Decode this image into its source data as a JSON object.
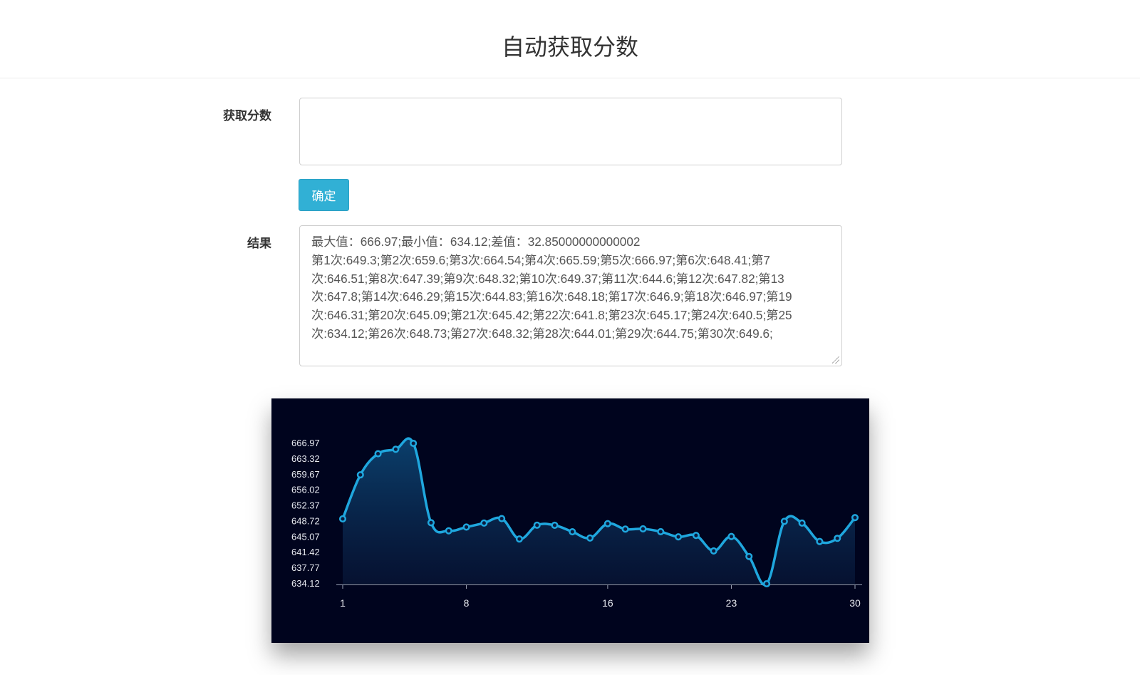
{
  "page": {
    "title": "自动获取分数"
  },
  "form": {
    "score_label": "获取分数",
    "score_value": "",
    "confirm_label": "确定",
    "result_label": "结果",
    "result_lines": [
      "最大值：666.97;最小值：634.12;差值：32.85000000000002",
      "第1次:649.3;第2次:659.6;第3次:664.54;第4次:665.59;第5次:666.97;第6次:648.41;第7",
      "次:646.51;第8次:647.39;第9次:648.32;第10次:649.37;第11次:644.6;第12次:647.82;第13",
      "次:647.8;第14次:646.29;第15次:644.83;第16次:648.18;第17次:646.9;第18次:646.97;第19",
      "次:646.31;第20次:645.09;第21次:645.42;第22次:641.8;第23次:645.17;第24次:640.5;第25",
      "次:634.12;第26次:648.73;第27次:648.32;第28次:644.01;第29次:644.75;第30次:649.6;"
    ]
  },
  "colors": {
    "chart_bg": "#00041e",
    "line": "#1fa7de",
    "axis": "#9aa3b5",
    "text": "#e6e9f0",
    "button": "#31b0d5"
  },
  "chart_data": {
    "type": "area",
    "x": [
      1,
      2,
      3,
      4,
      5,
      6,
      7,
      8,
      9,
      10,
      11,
      12,
      13,
      14,
      15,
      16,
      17,
      18,
      19,
      20,
      21,
      22,
      23,
      24,
      25,
      26,
      27,
      28,
      29,
      30
    ],
    "values": [
      649.3,
      659.6,
      664.54,
      665.59,
      666.97,
      648.41,
      646.51,
      647.39,
      648.32,
      649.37,
      644.6,
      647.82,
      647.8,
      646.29,
      644.83,
      648.18,
      646.9,
      646.97,
      646.31,
      645.09,
      645.42,
      641.8,
      645.17,
      640.5,
      634.12,
      648.73,
      648.32,
      644.01,
      644.75,
      649.6
    ],
    "x_ticks": [
      "1",
      "8",
      "16",
      "23",
      "30"
    ],
    "x_tick_values": [
      1,
      8,
      16,
      23,
      30
    ],
    "y_ticks": [
      "666.97",
      "663.32",
      "659.67",
      "656.02",
      "652.37",
      "648.72",
      "645.07",
      "641.42",
      "637.77",
      "634.12"
    ],
    "ylim": [
      634.12,
      666.97
    ],
    "grid": false,
    "smooth": true
  }
}
